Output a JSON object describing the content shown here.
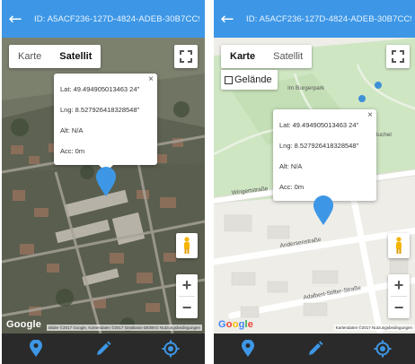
{
  "screens": [
    {
      "appbar": {
        "title": "ID: A5ACF236-127D-4824-ADEB-30B7CC9..."
      },
      "map_type": {
        "options": [
          "Karte",
          "Satellit"
        ],
        "active": "Satellit"
      },
      "popup": {
        "lat": "Lat: 49.494905013463 24\"",
        "lng": "Lng: 8.527926418328548\"",
        "alt": "Alt: N/A",
        "acc": "Acc: 0m"
      },
      "logo": "Google",
      "attribution": "Bilder ©2017 Google, Kartendaten ©2017 GeoBasis-DE/BKG  Nutzungsbedingungen"
    },
    {
      "appbar": {
        "title": "ID: A5ACF236-127D-4824-ADEB-30B7CC9..."
      },
      "map_type": {
        "options": [
          "Karte",
          "Satellit"
        ],
        "active": "Karte"
      },
      "terrain_label": "Gelände",
      "popup": {
        "lat": "Lat: 49.494905013463 24\"",
        "lng": "Lng: 8.527926418328548\"",
        "alt": "Alt: N/A",
        "acc": "Acc: 0m"
      },
      "logo": "Google",
      "attribution": "Kartendaten ©2017  Nutzungsbedingungen",
      "street_labels": [
        "Wingertstraße",
        "Andersenstraße",
        "Adalbert-Stifter-Straße",
        "Im Burgerpark",
        "Buchel"
      ]
    }
  ],
  "colors": {
    "appbar": "#3d97e6",
    "marker": "#3d97e6",
    "bottombar": "#2a2a2a",
    "nav_icon": "#3d97e6"
  },
  "nav_icons": [
    "location-pin-icon",
    "pencil-icon",
    "gps-target-icon"
  ]
}
